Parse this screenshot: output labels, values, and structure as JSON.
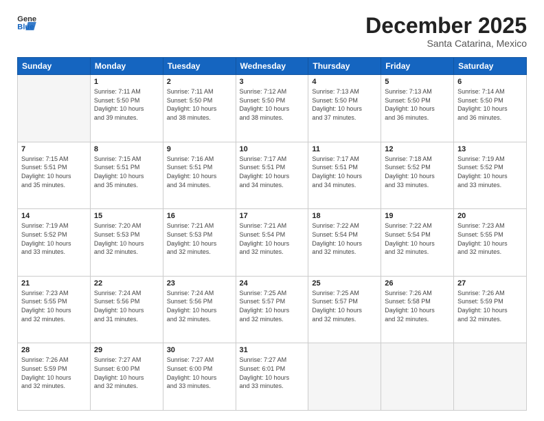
{
  "header": {
    "logo_general": "General",
    "logo_blue": "Blue",
    "month_title": "December 2025",
    "location": "Santa Catarina, Mexico"
  },
  "weekdays": [
    "Sunday",
    "Monday",
    "Tuesday",
    "Wednesday",
    "Thursday",
    "Friday",
    "Saturday"
  ],
  "weeks": [
    [
      {
        "day": "",
        "info": ""
      },
      {
        "day": "1",
        "info": "Sunrise: 7:11 AM\nSunset: 5:50 PM\nDaylight: 10 hours\nand 39 minutes."
      },
      {
        "day": "2",
        "info": "Sunrise: 7:11 AM\nSunset: 5:50 PM\nDaylight: 10 hours\nand 38 minutes."
      },
      {
        "day": "3",
        "info": "Sunrise: 7:12 AM\nSunset: 5:50 PM\nDaylight: 10 hours\nand 38 minutes."
      },
      {
        "day": "4",
        "info": "Sunrise: 7:13 AM\nSunset: 5:50 PM\nDaylight: 10 hours\nand 37 minutes."
      },
      {
        "day": "5",
        "info": "Sunrise: 7:13 AM\nSunset: 5:50 PM\nDaylight: 10 hours\nand 36 minutes."
      },
      {
        "day": "6",
        "info": "Sunrise: 7:14 AM\nSunset: 5:50 PM\nDaylight: 10 hours\nand 36 minutes."
      }
    ],
    [
      {
        "day": "7",
        "info": "Sunrise: 7:15 AM\nSunset: 5:51 PM\nDaylight: 10 hours\nand 35 minutes."
      },
      {
        "day": "8",
        "info": "Sunrise: 7:15 AM\nSunset: 5:51 PM\nDaylight: 10 hours\nand 35 minutes."
      },
      {
        "day": "9",
        "info": "Sunrise: 7:16 AM\nSunset: 5:51 PM\nDaylight: 10 hours\nand 34 minutes."
      },
      {
        "day": "10",
        "info": "Sunrise: 7:17 AM\nSunset: 5:51 PM\nDaylight: 10 hours\nand 34 minutes."
      },
      {
        "day": "11",
        "info": "Sunrise: 7:17 AM\nSunset: 5:51 PM\nDaylight: 10 hours\nand 34 minutes."
      },
      {
        "day": "12",
        "info": "Sunrise: 7:18 AM\nSunset: 5:52 PM\nDaylight: 10 hours\nand 33 minutes."
      },
      {
        "day": "13",
        "info": "Sunrise: 7:19 AM\nSunset: 5:52 PM\nDaylight: 10 hours\nand 33 minutes."
      }
    ],
    [
      {
        "day": "14",
        "info": "Sunrise: 7:19 AM\nSunset: 5:52 PM\nDaylight: 10 hours\nand 33 minutes."
      },
      {
        "day": "15",
        "info": "Sunrise: 7:20 AM\nSunset: 5:53 PM\nDaylight: 10 hours\nand 32 minutes."
      },
      {
        "day": "16",
        "info": "Sunrise: 7:21 AM\nSunset: 5:53 PM\nDaylight: 10 hours\nand 32 minutes."
      },
      {
        "day": "17",
        "info": "Sunrise: 7:21 AM\nSunset: 5:54 PM\nDaylight: 10 hours\nand 32 minutes."
      },
      {
        "day": "18",
        "info": "Sunrise: 7:22 AM\nSunset: 5:54 PM\nDaylight: 10 hours\nand 32 minutes."
      },
      {
        "day": "19",
        "info": "Sunrise: 7:22 AM\nSunset: 5:54 PM\nDaylight: 10 hours\nand 32 minutes."
      },
      {
        "day": "20",
        "info": "Sunrise: 7:23 AM\nSunset: 5:55 PM\nDaylight: 10 hours\nand 32 minutes."
      }
    ],
    [
      {
        "day": "21",
        "info": "Sunrise: 7:23 AM\nSunset: 5:55 PM\nDaylight: 10 hours\nand 32 minutes."
      },
      {
        "day": "22",
        "info": "Sunrise: 7:24 AM\nSunset: 5:56 PM\nDaylight: 10 hours\nand 31 minutes."
      },
      {
        "day": "23",
        "info": "Sunrise: 7:24 AM\nSunset: 5:56 PM\nDaylight: 10 hours\nand 32 minutes."
      },
      {
        "day": "24",
        "info": "Sunrise: 7:25 AM\nSunset: 5:57 PM\nDaylight: 10 hours\nand 32 minutes."
      },
      {
        "day": "25",
        "info": "Sunrise: 7:25 AM\nSunset: 5:57 PM\nDaylight: 10 hours\nand 32 minutes."
      },
      {
        "day": "26",
        "info": "Sunrise: 7:26 AM\nSunset: 5:58 PM\nDaylight: 10 hours\nand 32 minutes."
      },
      {
        "day": "27",
        "info": "Sunrise: 7:26 AM\nSunset: 5:59 PM\nDaylight: 10 hours\nand 32 minutes."
      }
    ],
    [
      {
        "day": "28",
        "info": "Sunrise: 7:26 AM\nSunset: 5:59 PM\nDaylight: 10 hours\nand 32 minutes."
      },
      {
        "day": "29",
        "info": "Sunrise: 7:27 AM\nSunset: 6:00 PM\nDaylight: 10 hours\nand 32 minutes."
      },
      {
        "day": "30",
        "info": "Sunrise: 7:27 AM\nSunset: 6:00 PM\nDaylight: 10 hours\nand 33 minutes."
      },
      {
        "day": "31",
        "info": "Sunrise: 7:27 AM\nSunset: 6:01 PM\nDaylight: 10 hours\nand 33 minutes."
      },
      {
        "day": "",
        "info": ""
      },
      {
        "day": "",
        "info": ""
      },
      {
        "day": "",
        "info": ""
      }
    ]
  ]
}
